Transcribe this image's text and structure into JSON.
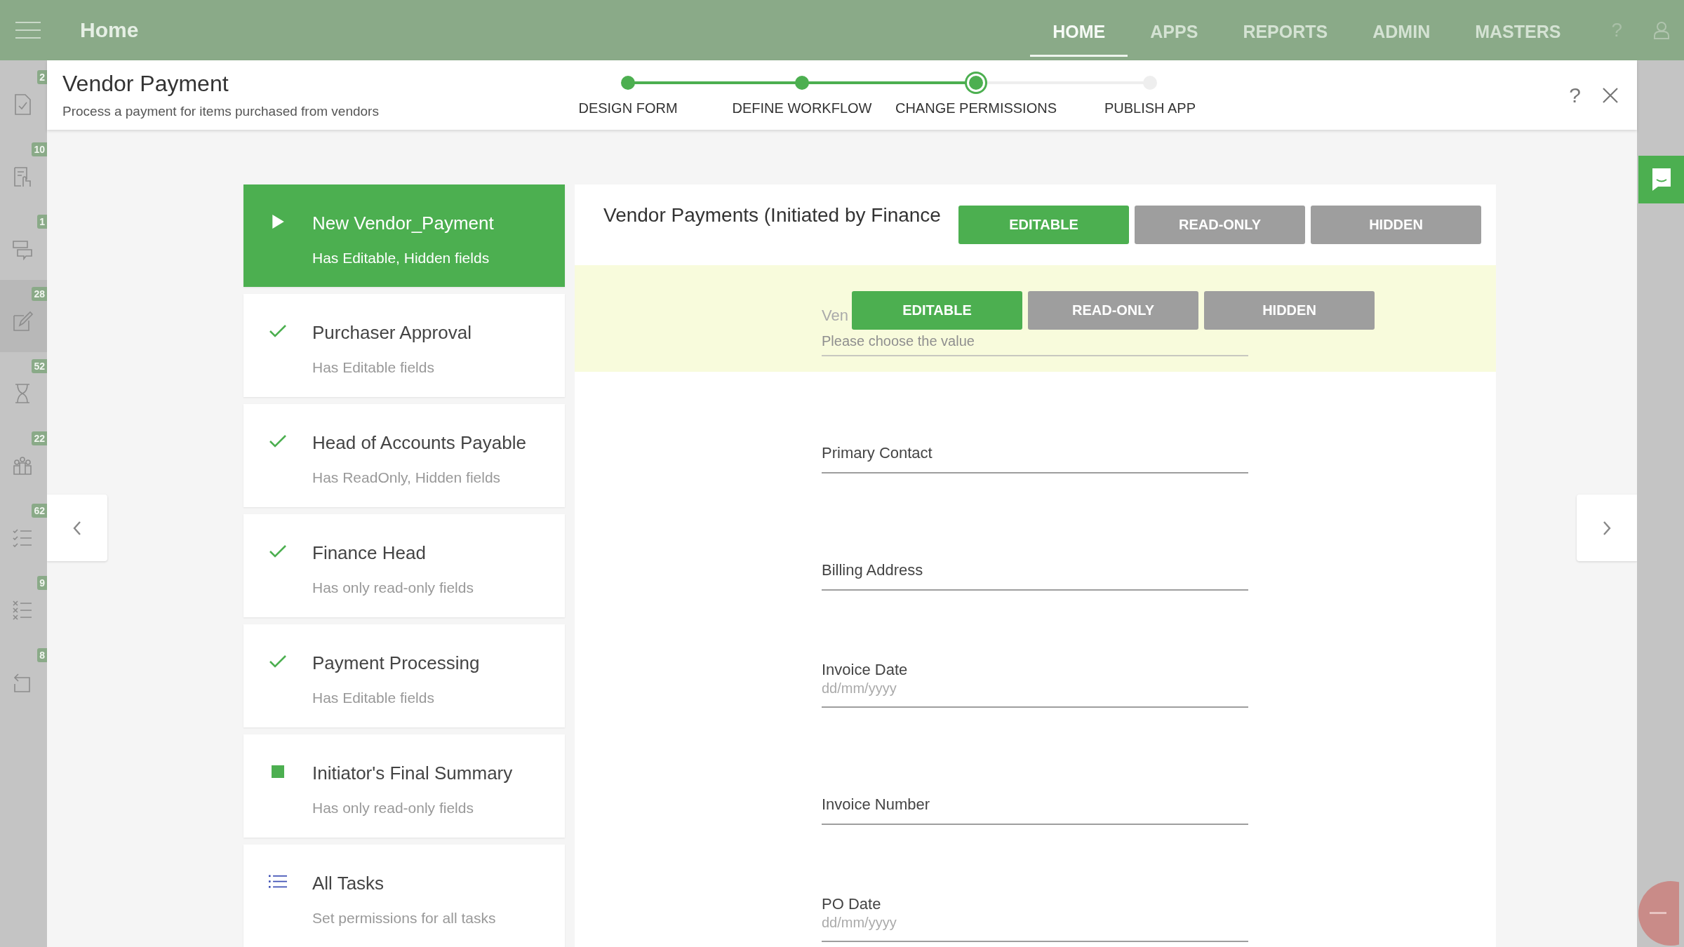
{
  "topbar": {
    "title": "Home",
    "nav": [
      {
        "label": "HOME",
        "selected": true
      },
      {
        "label": "APPS",
        "selected": false
      },
      {
        "label": "REPORTS",
        "selected": false
      },
      {
        "label": "ADMIN",
        "selected": false
      },
      {
        "label": "MASTERS",
        "selected": false
      }
    ],
    "help": "?"
  },
  "sidebar": {
    "items": [
      {
        "kind": "doc-check",
        "badge": "2",
        "selected": false
      },
      {
        "kind": "doc-hand",
        "badge": "10",
        "selected": false
      },
      {
        "kind": "chat",
        "badge": "1",
        "selected": false
      },
      {
        "kind": "edit",
        "badge": "28",
        "selected": true
      },
      {
        "kind": "hourglass",
        "badge": "52",
        "selected": false
      },
      {
        "kind": "people",
        "badge": "22",
        "selected": false
      },
      {
        "kind": "checklist",
        "badge": "62",
        "selected": false
      },
      {
        "kind": "xlist",
        "badge": "9",
        "selected": false
      },
      {
        "kind": "back",
        "badge": "8",
        "selected": false
      }
    ]
  },
  "modal": {
    "title": "Vendor Payment",
    "subtitle": "Process a payment for items purchased from vendors",
    "help": "?",
    "steps": [
      {
        "label": "DESIGN FORM",
        "completed": true,
        "selected": false
      },
      {
        "label": "DEFINE WORKFLOW",
        "completed": true,
        "selected": false
      },
      {
        "label": "CHANGE PERMISSIONS",
        "completed": true,
        "selected": true
      },
      {
        "label": "PUBLISH APP",
        "completed": false,
        "selected": false
      }
    ]
  },
  "tasks": [
    {
      "name": "New Vendor_Payment",
      "description": "Has Editable, Hidden fields",
      "kind": "play",
      "selected": true
    },
    {
      "name": "Purchaser Approval",
      "description": "Has Editable fields",
      "kind": "check",
      "selected": false
    },
    {
      "name": "Head of Accounts Payable",
      "description": "Has ReadOnly, Hidden fields",
      "kind": "check",
      "selected": false
    },
    {
      "name": "Finance Head",
      "description": "Has only read-only fields",
      "kind": "check",
      "selected": false
    },
    {
      "name": "Payment Processing",
      "description": "Has Editable fields",
      "kind": "check",
      "selected": false
    },
    {
      "name": "Initiator's Final Summary",
      "description": "Has only read-only fields",
      "kind": "square",
      "selected": false
    },
    {
      "name": "All Tasks",
      "description": "Set permissions for all tasks",
      "kind": "list",
      "selected": false
    }
  ],
  "form": {
    "title": "Vendor Payments (Initiated by Finance",
    "permissions": [
      {
        "label": "EDITABLE",
        "selected": true
      },
      {
        "label": "READ-ONLY",
        "selected": false
      },
      {
        "label": "HIDDEN",
        "selected": false
      }
    ],
    "fields": [
      {
        "label": "Ven",
        "placeholder": "Please choose the value",
        "highlighted": true,
        "permissions": [
          {
            "label": "EDITABLE",
            "selected": true
          },
          {
            "label": "READ-ONLY",
            "selected": false
          },
          {
            "label": "HIDDEN",
            "selected": false
          }
        ]
      },
      {
        "label": "Primary Contact",
        "highlighted": false
      },
      {
        "label": "Billing Address",
        "highlighted": false
      },
      {
        "label": "Invoice Date",
        "placeholder": "dd/mm/yyyy",
        "highlighted": false
      },
      {
        "label": "Invoice Number",
        "highlighted": false
      },
      {
        "label": "PO Date",
        "placeholder": "dd/mm/yyyy",
        "highlighted": false
      }
    ]
  }
}
